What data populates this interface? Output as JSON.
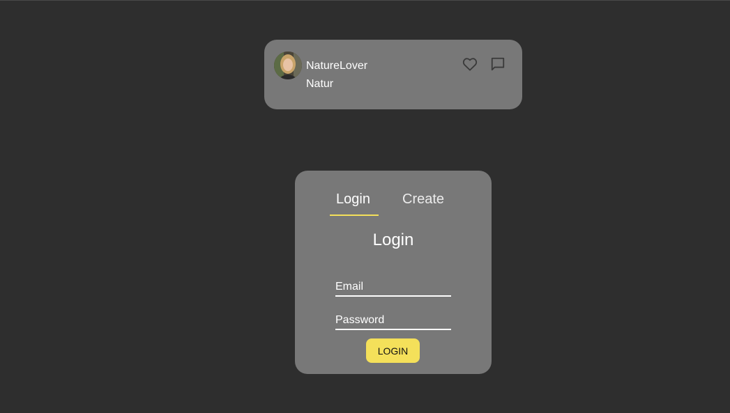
{
  "post": {
    "avatar_icon": "user-photo-avatar",
    "username": "NatureLover",
    "text": "Natur",
    "like_icon": "heart-outline-icon",
    "comment_icon": "comment-bubble-icon"
  },
  "auth": {
    "tabs": [
      {
        "label": "Login",
        "active": true
      },
      {
        "label": "Create",
        "active": false
      }
    ],
    "title": "Login",
    "email_placeholder": "Email",
    "password_placeholder": "Password",
    "submit_label": "LOGIN"
  },
  "colors": {
    "background": "#2e2e2e",
    "card": "#787878",
    "accent": "#f4e05a",
    "text": "#ffffff"
  }
}
